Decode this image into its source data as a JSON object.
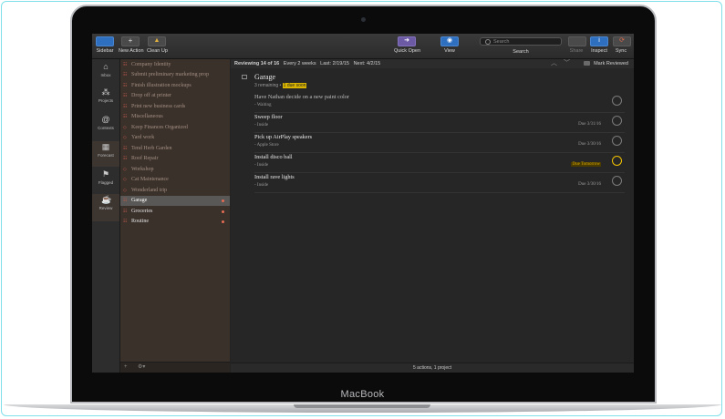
{
  "device": {
    "brand": "MacBook"
  },
  "toolbar": {
    "sidebar": "Sidebar",
    "new_action": "New Action",
    "clean_up": "Clean Up",
    "quick_open": "Quick Open",
    "view": "View",
    "search_placeholder": "Search",
    "search_label": "Search",
    "share": "Share",
    "inspect": "Inspect",
    "sync": "Sync"
  },
  "perspectives": [
    {
      "label": "Inbox",
      "icon": "inbox-icon"
    },
    {
      "label": "Projects",
      "icon": "projects-icon"
    },
    {
      "label": "Contexts",
      "icon": "contexts-icon"
    },
    {
      "label": "Forecast",
      "icon": "forecast-icon"
    },
    {
      "label": "Flagged",
      "icon": "flag-icon"
    },
    {
      "label": "Review",
      "icon": "review-icon"
    }
  ],
  "projects": [
    {
      "label": "Company Identity"
    },
    {
      "label": "Submit preliminary marketing prop"
    },
    {
      "label": "Finish illustration mockups"
    },
    {
      "label": "Drop off at printer"
    },
    {
      "label": "Print new business cards"
    },
    {
      "label": "Miscellaneous"
    },
    {
      "label": "Keep Finances Organized"
    },
    {
      "label": "Yard work"
    },
    {
      "label": "Tend Herb Garden"
    },
    {
      "label": "Roof Repair"
    },
    {
      "label": "Workshop"
    },
    {
      "label": "Cat Maintenance"
    },
    {
      "label": "Wonderland trip"
    },
    {
      "label": "Garage"
    },
    {
      "label": "Groceries"
    },
    {
      "label": "Routine"
    }
  ],
  "sidebar_footer": {
    "add": "+",
    "gear": "⚙▾"
  },
  "review": {
    "reviewing": "Reviewing 14 of 16",
    "every": "Every 2 weeks",
    "last": "Last: 2/19/15",
    "next": "Next: 4/2/15",
    "mark_reviewed": "Mark Reviewed"
  },
  "project": {
    "title": "Garage",
    "remaining": "3 remaining",
    "sep": " • ",
    "due_soon": "1 due soon"
  },
  "actions": [
    {
      "title": "Have Nathan decide on a new paint color",
      "context": "- Waiting",
      "due": ""
    },
    {
      "title": "Sweep floor",
      "context": "- Inside",
      "due": "Due 3/31/16"
    },
    {
      "title": "Pick up AirPlay speakers",
      "context": "- Apple Store",
      "due": "Due 3/30/16"
    },
    {
      "title": "Install disco ball",
      "context": "- Inside",
      "due": "Due Tomorrow"
    },
    {
      "title": "Install rave lights",
      "context": "- Inside",
      "due": "Due 3/30/16"
    }
  ],
  "status": "5 actions, 1 project"
}
